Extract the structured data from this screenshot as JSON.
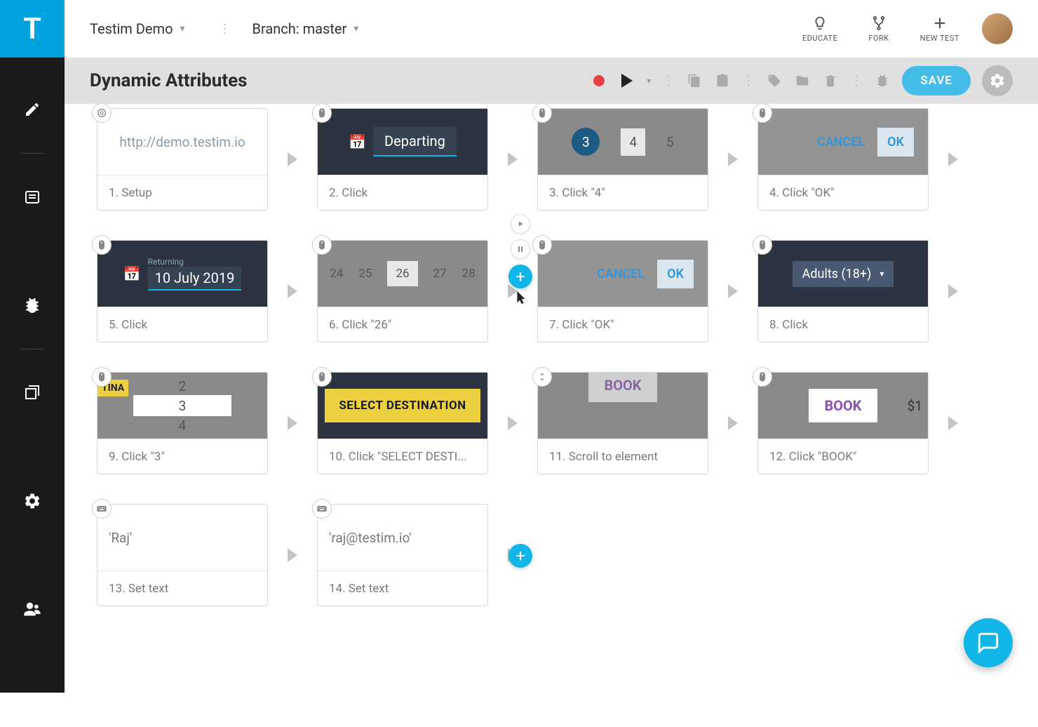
{
  "logo": "T",
  "header": {
    "project": "Testim Demo",
    "branch_label": "Branch: master",
    "actions": [
      {
        "label": "EDUCATE",
        "icon": "lightbulb"
      },
      {
        "label": "FORK",
        "icon": "fork"
      },
      {
        "label": "NEW TEST",
        "icon": "plus"
      }
    ]
  },
  "toolbar": {
    "title": "Dynamic Attributes",
    "save_label": "SAVE"
  },
  "steps": [
    {
      "label": "1. Setup",
      "type": "url",
      "text": "http://demo.testim.io",
      "icon": "target"
    },
    {
      "label": "2. Click",
      "type": "depart",
      "text": "Departing",
      "icon": "mouse"
    },
    {
      "label": "3. Click \"4\"",
      "type": "calnum",
      "sel": "4",
      "nums": [
        "3",
        "4",
        "5"
      ],
      "icon": "mouse"
    },
    {
      "label": "4. Click \"OK\"",
      "type": "dialog",
      "cancel": "CANCEL",
      "ok": "OK",
      "icon": "mouse"
    },
    {
      "label": "5. Click",
      "type": "return",
      "date_label": "Returning",
      "date": "10 July 2019",
      "icon": "mouse"
    },
    {
      "label": "6. Click \"26\"",
      "type": "calnum2",
      "sel": "26",
      "nums": [
        "24",
        "25",
        "26",
        "27",
        "28"
      ],
      "icon": "mouse"
    },
    {
      "label": "7. Click \"OK\"",
      "type": "dialog",
      "cancel": "CANCEL",
      "ok": "OK",
      "icon": "mouse"
    },
    {
      "label": "8. Click",
      "type": "dropdown",
      "text": "Adults (18+)",
      "icon": "mouse"
    },
    {
      "label": "9. Click \"3\"",
      "type": "list3",
      "sel": "3",
      "partial": "TINA",
      "icon": "mouse"
    },
    {
      "label": "10. Click \"SELECT DESTI...",
      "type": "yellow",
      "text": "SELECT DESTINATION",
      "icon": "mouse"
    },
    {
      "label": "11. Scroll to element",
      "type": "scrollbook",
      "text": "BOOK",
      "icon": "scroll"
    },
    {
      "label": "12. Click \"BOOK\"",
      "type": "book",
      "text": "BOOK",
      "price": "$1",
      "icon": "mouse"
    },
    {
      "label": "13. Set text",
      "type": "text",
      "text": "'Raj'",
      "icon": "keyboard"
    },
    {
      "label": "14. Set text",
      "type": "text",
      "text": "'raj@testim.io'",
      "icon": "keyboard"
    }
  ]
}
